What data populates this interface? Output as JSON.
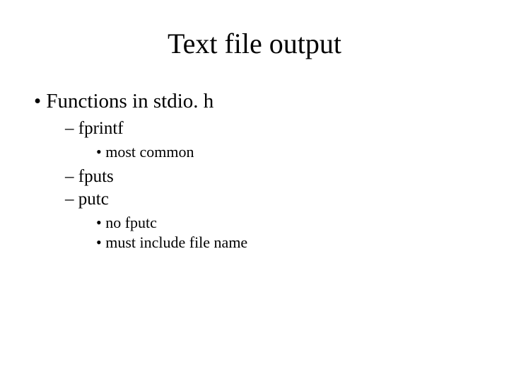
{
  "title": "Text file output",
  "bullets": {
    "lvl1_0": "Functions in stdio. h",
    "lvl2_0": "fprintf",
    "lvl3_0": "most common",
    "lvl2_1": "fputs",
    "lvl2_2": "putc",
    "lvl3_1": "no fputc",
    "lvl3_2": "must include file name"
  }
}
